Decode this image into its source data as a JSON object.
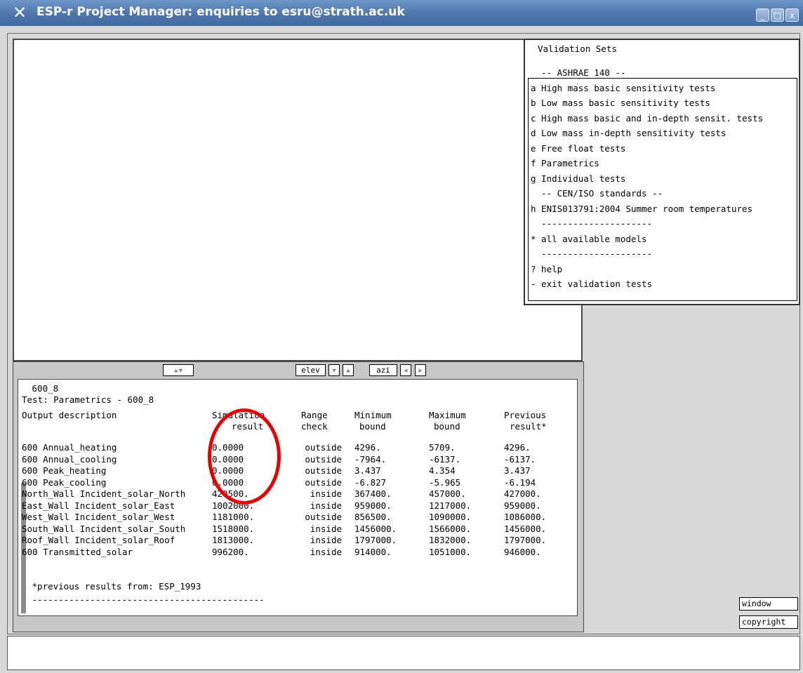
{
  "window": {
    "title": "ESP-r Project Manager: enquiries to esru@strath.ac.uk",
    "app_icon": "x-logo-icon",
    "minimize_glyph": "_",
    "maximize_glyph": "□",
    "close_glyph": "x"
  },
  "view_controls": {
    "updown": "▵▿",
    "elev": "elev",
    "elev_down": "▿",
    "elev_up": "▵",
    "azi": "azi",
    "azi_left": "◃",
    "azi_right": "▹"
  },
  "menu": {
    "title": "Validation Sets",
    "items": [
      "  -- ASHRAE 140 --",
      "a High mass basic sensitivity tests",
      "b Low mass basic sensitivity tests",
      "c High mass basic and in-depth sensit. tests",
      "d Low mass in-depth sensitivity tests",
      "e Free float tests",
      "f Parametrics",
      "g Individual tests",
      "  -- CEN/ISO standards --",
      "h ENIS013791:2004 Summer room temperatures",
      "  ---------------------",
      "* all available models",
      "  ---------------------",
      "? help",
      "- exit validation tests"
    ]
  },
  "results": {
    "header_line": " 600_8",
    "test_line": "Test: Parametrics - 600_8",
    "columns_row1": [
      "Output description",
      "Simulation",
      "Range",
      "Minimum",
      "Maximum",
      "Previous"
    ],
    "columns_row2": [
      "",
      "result",
      "check",
      "bound",
      "bound",
      "result*"
    ],
    "rows": [
      [
        "600 Annual_heating",
        "0.0000",
        "outside",
        "4296.",
        "5709.",
        "4296."
      ],
      [
        "600 Annual_cooling",
        "0.0000",
        "outside",
        "-7964.",
        "-6137.",
        "-6137."
      ],
      [
        "600 Peak_heating",
        "0.0000",
        "outside",
        "3.437",
        "4.354",
        "3.437"
      ],
      [
        "600 Peak_cooling",
        "0.0000",
        "outside",
        "-6.827",
        "-5.965",
        "-6.194"
      ],
      [
        "North_Wall Incident_solar_North",
        "420500.",
        "inside",
        "367400.",
        "457000.",
        "427000."
      ],
      [
        "East_Wall Incident_solar_East",
        "1002000.",
        "inside",
        "959000.",
        "1217000.",
        "959000."
      ],
      [
        "West_Wall Incident_solar_West",
        "1181000.",
        "outside",
        "856500.",
        "1090000.",
        "1086000."
      ],
      [
        "South_Wall Incident_solar_South",
        "1518000.",
        "inside",
        "1456000.",
        "1566000.",
        "1456000."
      ],
      [
        "Roof_Wall Incident_solar_Roof",
        "1813000.",
        "inside",
        "1797000.",
        "1832000.",
        "1797000."
      ],
      [
        "600 Transmitted_solar",
        "996200.",
        "inside",
        "914000.",
        "1051000.",
        "946000."
      ]
    ],
    "footnote": " *previous results from: ESP_1993",
    "separator": " --------------------------------------------"
  },
  "side_buttons": {
    "window": "window",
    "copyright": "copyright"
  },
  "colors": {
    "title_bar": "#4f76ab",
    "highlight_circle": "#e80000"
  }
}
